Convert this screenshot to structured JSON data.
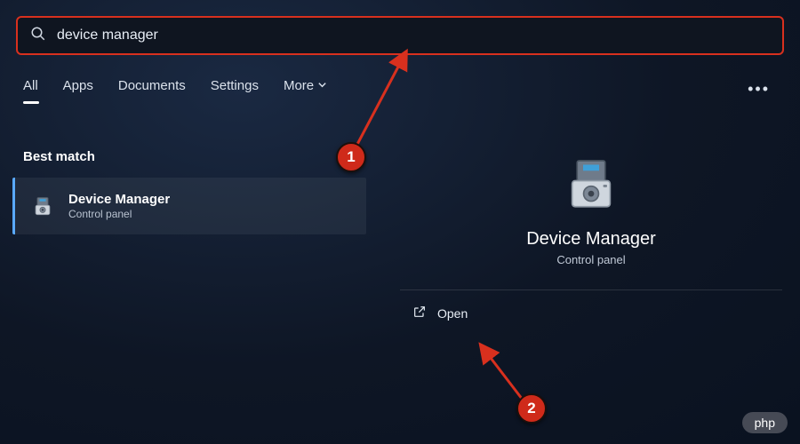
{
  "search": {
    "value": "device manager"
  },
  "tabs": {
    "items": [
      "All",
      "Apps",
      "Documents",
      "Settings",
      "More"
    ],
    "active_index": 0
  },
  "section_label": "Best match",
  "result": {
    "title": "Device Manager",
    "subtitle": "Control panel"
  },
  "detail": {
    "title": "Device Manager",
    "subtitle": "Control panel",
    "open_label": "Open"
  },
  "annotations": {
    "marker1": "1",
    "marker2": "2"
  },
  "watermark": "php"
}
